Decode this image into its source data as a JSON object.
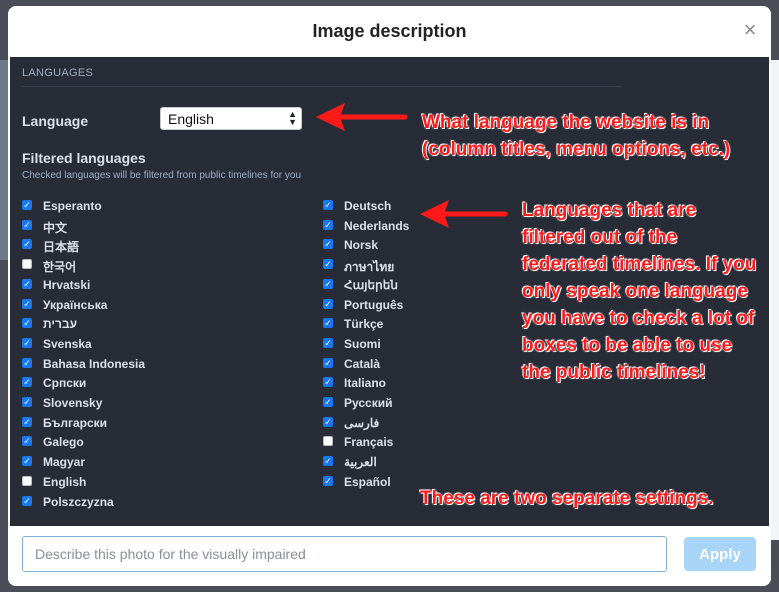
{
  "modal": {
    "title": "Image description",
    "close_label": "×"
  },
  "settings": {
    "section_title": "LANGUAGES",
    "language_label": "Language",
    "language_value": "English",
    "select_arrows": "▲▼",
    "filtered_title": "Filtered languages",
    "filtered_hint": "Checked languages will be filtered from public timelines for you",
    "left_languages": [
      {
        "label": "Esperanto",
        "checked": true
      },
      {
        "label": "中文",
        "checked": true
      },
      {
        "label": "日本語",
        "checked": true
      },
      {
        "label": "한국어",
        "checked": false
      },
      {
        "label": "Hrvatski",
        "checked": true
      },
      {
        "label": "Українська",
        "checked": true
      },
      {
        "label": "עברית",
        "checked": true
      },
      {
        "label": "Svenska",
        "checked": true
      },
      {
        "label": "Bahasa Indonesia",
        "checked": true
      },
      {
        "label": "Српски",
        "checked": true
      },
      {
        "label": "Slovensky",
        "checked": true
      },
      {
        "label": "Български",
        "checked": true
      },
      {
        "label": "Galego",
        "checked": true
      },
      {
        "label": "Magyar",
        "checked": true
      },
      {
        "label": "English",
        "checked": false
      },
      {
        "label": "Polszczyzna",
        "checked": true
      }
    ],
    "right_languages": [
      {
        "label": "Deutsch",
        "checked": true
      },
      {
        "label": "Nederlands",
        "checked": true
      },
      {
        "label": "Norsk",
        "checked": true
      },
      {
        "label": "ภาษาไทย",
        "checked": true
      },
      {
        "label": "Հայերեն",
        "checked": true
      },
      {
        "label": "Português",
        "checked": true
      },
      {
        "label": "Türkçe",
        "checked": true
      },
      {
        "label": "Suomi",
        "checked": true
      },
      {
        "label": "Català",
        "checked": true
      },
      {
        "label": "Italiano",
        "checked": true
      },
      {
        "label": "Русский",
        "checked": true
      },
      {
        "label": "فارسی",
        "checked": true
      },
      {
        "label": "Français",
        "checked": false
      },
      {
        "label": "العربية",
        "checked": true
      },
      {
        "label": "Español",
        "checked": true
      }
    ]
  },
  "annotations": {
    "note_language": "What language the website is in (column titles, menu options, etc.)",
    "note_filtered": "Languages that are filtered out of the federated timelines. If you only speak one language you have to check a lot of boxes to be able to use the public timelines!",
    "note_separate": "These are two separate settings."
  },
  "footer": {
    "description_placeholder": "Describe this photo for the visually impaired",
    "description_value": "",
    "apply_label": "Apply"
  },
  "colors": {
    "panel_bg": "#282c37",
    "accent": "#1877f2",
    "annotation_red": "#ff1a1a",
    "apply_disabled": "#a7d4f7"
  }
}
